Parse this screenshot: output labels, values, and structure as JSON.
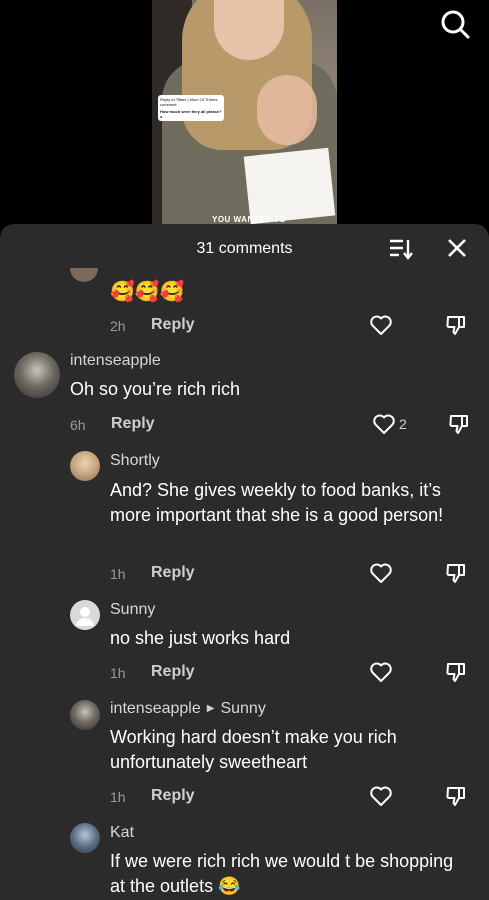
{
  "video": {
    "question_header": "Reply to Tiffani | Mom Of Threes comment",
    "question_text": "How much were they all please? x",
    "caption": "YOU WANTED TO"
  },
  "header": {
    "comments_count_label": "31 comments",
    "sort_icon": "sort-icon",
    "close_icon": "close-icon"
  },
  "comments": [
    {
      "text": "🥰🥰🥰",
      "time": "2h",
      "reply": "Reply"
    },
    {
      "username": "intenseapple",
      "text": "Oh so you’re rich rich",
      "time": "6h",
      "reply": "Reply",
      "like_count": "2"
    },
    {
      "username": "Shortly",
      "text": "And? She gives weekly to food banks, it’s more important that she is a good person!",
      "time": "1h",
      "reply": "Reply"
    },
    {
      "username": "Sunny",
      "text": "no she just works hard",
      "time": "1h",
      "reply": "Reply"
    },
    {
      "username": "intenseapple",
      "reply_to": "Sunny",
      "text": "Working hard doesn’t make you rich unfortunately sweetheart",
      "time": "1h",
      "reply": "Reply"
    },
    {
      "username": "Kat",
      "text": "If we were rich rich we would t be shopping at the outlets 😂"
    }
  ],
  "colors": {
    "sheet_bg": "#2b2b2b",
    "muted": "#9a9a9a"
  }
}
